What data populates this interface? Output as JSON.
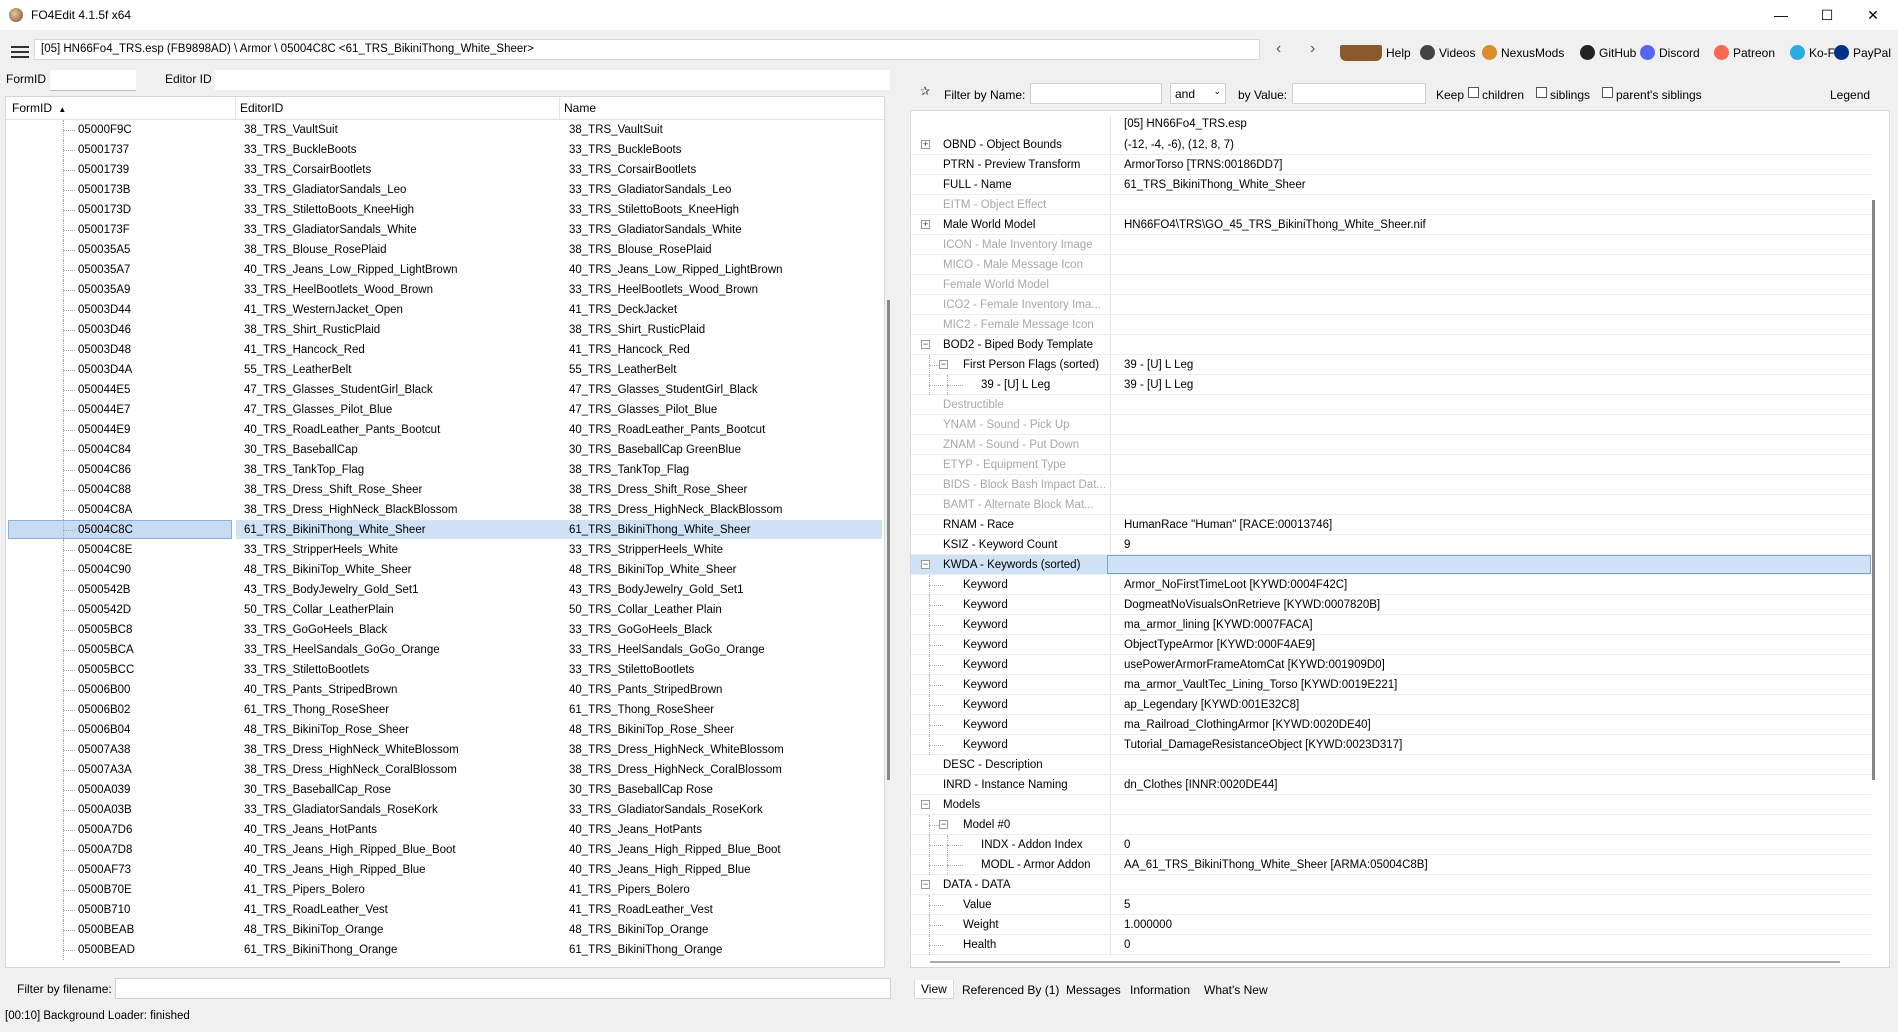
{
  "window": {
    "title": "FO4Edit 4.1.5f x64",
    "minimize": "—",
    "maximize": "☐",
    "close": "✕"
  },
  "toolbar": {
    "path": "[05] HN66Fo4_TRS.esp (FB9898AD) \\ Armor \\ 05004C8C <61_TRS_BikiniThong_White_Sheer>",
    "back": "‹",
    "forward": "›",
    "links": [
      {
        "label": "Help",
        "icon": "book-icon",
        "color": "#8b5a2b"
      },
      {
        "label": "Videos",
        "icon": "videos-icon",
        "color": "#444444"
      },
      {
        "label": "NexusMods",
        "icon": "nexusmods-icon",
        "color": "#d98e2b"
      },
      {
        "label": "GitHub",
        "icon": "github-icon",
        "color": "#222222"
      },
      {
        "label": "Discord",
        "icon": "discord-icon",
        "color": "#5865f2"
      },
      {
        "label": "Patreon",
        "icon": "patreon-icon",
        "color": "#f96854"
      },
      {
        "label": "Ko-Fi",
        "icon": "kofi-icon",
        "color": "#29abe0"
      },
      {
        "label": "PayPal",
        "icon": "paypal-icon",
        "color": "#003087"
      }
    ]
  },
  "search": {
    "formid_label": "FormID",
    "editorid_label": "Editor ID"
  },
  "left": {
    "columns": [
      "FormID",
      "EditorID",
      "Name"
    ],
    "sort_indicator": "▲",
    "rows": [
      {
        "formid": "05000F9C",
        "editorid": "38_TRS_VaultSuit",
        "name": "38_TRS_VaultSuit"
      },
      {
        "formid": "05001737",
        "editorid": "33_TRS_BuckleBoots",
        "name": "33_TRS_BuckleBoots"
      },
      {
        "formid": "05001739",
        "editorid": "33_TRS_CorsairBootlets",
        "name": "33_TRS_CorsairBootlets"
      },
      {
        "formid": "0500173B",
        "editorid": "33_TRS_GladiatorSandals_Leo",
        "name": "33_TRS_GladiatorSandals_Leo"
      },
      {
        "formid": "0500173D",
        "editorid": "33_TRS_StilettoBoots_KneeHigh",
        "name": "33_TRS_StilettoBoots_KneeHigh"
      },
      {
        "formid": "0500173F",
        "editorid": "33_TRS_GladiatorSandals_White",
        "name": "33_TRS_GladiatorSandals_White"
      },
      {
        "formid": "050035A5",
        "editorid": "38_TRS_Blouse_RosePlaid",
        "name": "38_TRS_Blouse_RosePlaid"
      },
      {
        "formid": "050035A7",
        "editorid": "40_TRS_Jeans_Low_Ripped_LightBrown",
        "name": "40_TRS_Jeans_Low_Ripped_LightBrown"
      },
      {
        "formid": "050035A9",
        "editorid": "33_TRS_HeelBootlets_Wood_Brown",
        "name": "33_TRS_HeelBootlets_Wood_Brown"
      },
      {
        "formid": "05003D44",
        "editorid": "41_TRS_WesternJacket_Open",
        "name": "41_TRS_DeckJacket"
      },
      {
        "formid": "05003D46",
        "editorid": "38_TRS_Shirt_RusticPlaid",
        "name": "38_TRS_Shirt_RusticPlaid"
      },
      {
        "formid": "05003D48",
        "editorid": "41_TRS_Hancock_Red",
        "name": "41_TRS_Hancock_Red"
      },
      {
        "formid": "05003D4A",
        "editorid": "55_TRS_LeatherBelt",
        "name": "55_TRS_LeatherBelt"
      },
      {
        "formid": "050044E5",
        "editorid": "47_TRS_Glasses_StudentGirl_Black",
        "name": "47_TRS_Glasses_StudentGirl_Black"
      },
      {
        "formid": "050044E7",
        "editorid": "47_TRS_Glasses_Pilot_Blue",
        "name": "47_TRS_Glasses_Pilot_Blue"
      },
      {
        "formid": "050044E9",
        "editorid": "40_TRS_RoadLeather_Pants_Bootcut",
        "name": "40_TRS_RoadLeather_Pants_Bootcut"
      },
      {
        "formid": "05004C84",
        "editorid": "30_TRS_BaseballCap",
        "name": "30_TRS_BaseballCap GreenBlue"
      },
      {
        "formid": "05004C86",
        "editorid": "38_TRS_TankTop_Flag",
        "name": "38_TRS_TankTop_Flag"
      },
      {
        "formid": "05004C88",
        "editorid": "38_TRS_Dress_Shift_Rose_Sheer",
        "name": "38_TRS_Dress_Shift_Rose_Sheer"
      },
      {
        "formid": "05004C8A",
        "editorid": "38_TRS_Dress_HighNeck_BlackBlossom",
        "name": "38_TRS_Dress_HighNeck_BlackBlossom"
      },
      {
        "formid": "05004C8C",
        "editorid": "61_TRS_BikiniThong_White_Sheer",
        "name": "61_TRS_BikiniThong_White_Sheer",
        "selected": true
      },
      {
        "formid": "05004C8E",
        "editorid": "33_TRS_StripperHeels_White",
        "name": "33_TRS_StripperHeels_White"
      },
      {
        "formid": "05004C90",
        "editorid": "48_TRS_BikiniTop_White_Sheer",
        "name": "48_TRS_BikiniTop_White_Sheer"
      },
      {
        "formid": "0500542B",
        "editorid": "43_TRS_BodyJewelry_Gold_Set1",
        "name": "43_TRS_BodyJewelry_Gold_Set1"
      },
      {
        "formid": "0500542D",
        "editorid": "50_TRS_Collar_LeatherPlain",
        "name": "50_TRS_Collar_Leather Plain"
      },
      {
        "formid": "05005BC8",
        "editorid": "33_TRS_GoGoHeels_Black",
        "name": "33_TRS_GoGoHeels_Black"
      },
      {
        "formid": "05005BCA",
        "editorid": "33_TRS_HeelSandals_GoGo_Orange",
        "name": "33_TRS_HeelSandals_GoGo_Orange"
      },
      {
        "formid": "05005BCC",
        "editorid": "33_TRS_StilettoBootlets",
        "name": "33_TRS_StilettoBootlets"
      },
      {
        "formid": "05006B00",
        "editorid": "40_TRS_Pants_StripedBrown",
        "name": "40_TRS_Pants_StripedBrown"
      },
      {
        "formid": "05006B02",
        "editorid": "61_TRS_Thong_RoseSheer",
        "name": "61_TRS_Thong_RoseSheer"
      },
      {
        "formid": "05006B04",
        "editorid": "48_TRS_BikiniTop_Rose_Sheer",
        "name": "48_TRS_BikiniTop_Rose_Sheer"
      },
      {
        "formid": "05007A38",
        "editorid": "38_TRS_Dress_HighNeck_WhiteBlossom",
        "name": "38_TRS_Dress_HighNeck_WhiteBlossom"
      },
      {
        "formid": "05007A3A",
        "editorid": "38_TRS_Dress_HighNeck_CoralBlossom",
        "name": "38_TRS_Dress_HighNeck_CoralBlossom"
      },
      {
        "formid": "0500A039",
        "editorid": "30_TRS_BaseballCap_Rose",
        "name": "30_TRS_BaseballCap Rose"
      },
      {
        "formid": "0500A03B",
        "editorid": "33_TRS_GladiatorSandals_RoseKork",
        "name": "33_TRS_GladiatorSandals_RoseKork"
      },
      {
        "formid": "0500A7D6",
        "editorid": "40_TRS_Jeans_HotPants",
        "name": "40_TRS_Jeans_HotPants"
      },
      {
        "formid": "0500A7D8",
        "editorid": "40_TRS_Jeans_High_Ripped_Blue_Boot",
        "name": "40_TRS_Jeans_High_Ripped_Blue_Boot"
      },
      {
        "formid": "0500AF73",
        "editorid": "40_TRS_Jeans_High_Ripped_Blue",
        "name": "40_TRS_Jeans_High_Ripped_Blue"
      },
      {
        "formid": "0500B70E",
        "editorid": "41_TRS_Pipers_Bolero",
        "name": "41_TRS_Pipers_Bolero"
      },
      {
        "formid": "0500B710",
        "editorid": "41_TRS_RoadLeather_Vest",
        "name": "41_TRS_RoadLeather_Vest"
      },
      {
        "formid": "0500BEAB",
        "editorid": "48_TRS_BikiniTop_Orange",
        "name": "48_TRS_BikiniTop_Orange"
      },
      {
        "formid": "0500BEAD",
        "editorid": "61_TRS_BikiniThong_Orange",
        "name": "61_TRS_BikiniThong_Orange"
      }
    ],
    "filter_label": "Filter by filename:"
  },
  "right": {
    "filter": {
      "name_label": "Filter by Name:",
      "op": "and",
      "value_label": "by Value:",
      "keep_label": "Keep",
      "children": "children",
      "siblings": "siblings",
      "parents_siblings": "parent's siblings",
      "legend": "Legend"
    },
    "file_header": "[05] HN66Fo4_TRS.esp",
    "rows": [
      {
        "label": "OBND - Object Bounds",
        "value": "(-12, -4, -6), (12, 8, 7)",
        "level": 0,
        "expander": "+"
      },
      {
        "label": "PTRN - Preview Transform",
        "value": "ArmorTorso [TRNS:00186DD7]",
        "level": 0
      },
      {
        "label": "FULL - Name",
        "value": "61_TRS_BikiniThong_White_Sheer",
        "level": 0
      },
      {
        "label": "EITM - Object Effect",
        "value": "",
        "level": 0,
        "dim": true
      },
      {
        "label": "Male World Model",
        "value": "HN66FO4\\TRS\\GO_45_TRS_BikiniThong_White_Sheer.nif",
        "level": 0,
        "expander": "+"
      },
      {
        "label": "ICON - Male Inventory Image",
        "value": "",
        "level": 0,
        "dim": true
      },
      {
        "label": "MICO - Male Message Icon",
        "value": "",
        "level": 0,
        "dim": true
      },
      {
        "label": "Female World Model",
        "value": "",
        "level": 0,
        "dim": true
      },
      {
        "label": "ICO2 - Female Inventory Ima...",
        "value": "",
        "level": 0,
        "dim": true
      },
      {
        "label": "MIC2 - Female Message Icon",
        "value": "",
        "level": 0,
        "dim": true
      },
      {
        "label": "BOD2 - Biped Body Template",
        "value": "",
        "level": 0,
        "expander": "−"
      },
      {
        "label": "First Person Flags (sorted)",
        "value": "39 - [U] L Leg",
        "level": 1,
        "expander": "−"
      },
      {
        "label": "39 - [U] L Leg",
        "value": "39 - [U] L Leg",
        "level": 2
      },
      {
        "label": "Destructible",
        "value": "",
        "level": 0,
        "dim": true
      },
      {
        "label": "YNAM - Sound - Pick Up",
        "value": "",
        "level": 0,
        "dim": true
      },
      {
        "label": "ZNAM - Sound - Put Down",
        "value": "",
        "level": 0,
        "dim": true
      },
      {
        "label": "ETYP - Equipment Type",
        "value": "",
        "level": 0,
        "dim": true
      },
      {
        "label": "BIDS - Block Bash Impact Dat...",
        "value": "",
        "level": 0,
        "dim": true
      },
      {
        "label": "BAMT - Alternate Block Mat...",
        "value": "",
        "level": 0,
        "dim": true
      },
      {
        "label": "RNAM - Race",
        "value": "HumanRace \"Human\" [RACE:00013746]",
        "level": 0
      },
      {
        "label": "KSIZ - Keyword Count",
        "value": "9",
        "level": 0
      },
      {
        "label": "KWDA - Keywords (sorted)",
        "value": "",
        "level": 0,
        "expander": "−",
        "highlight": true
      },
      {
        "label": "Keyword",
        "value": "Armor_NoFirstTimeLoot [KYWD:0004F42C]",
        "level": 1
      },
      {
        "label": "Keyword",
        "value": "DogmeatNoVisualsOnRetrieve [KYWD:0007820B]",
        "level": 1
      },
      {
        "label": "Keyword",
        "value": "ma_armor_lining [KYWD:0007FACA]",
        "level": 1
      },
      {
        "label": "Keyword",
        "value": "ObjectTypeArmor [KYWD:000F4AE9]",
        "level": 1
      },
      {
        "label": "Keyword",
        "value": "usePowerArmorFrameAtomCat [KYWD:001909D0]",
        "level": 1
      },
      {
        "label": "Keyword",
        "value": "ma_armor_VaultTec_Lining_Torso [KYWD:0019E221]",
        "level": 1
      },
      {
        "label": "Keyword",
        "value": "ap_Legendary [KYWD:001E32C8]",
        "level": 1
      },
      {
        "label": "Keyword",
        "value": "ma_Railroad_ClothingArmor [KYWD:0020DE40]",
        "level": 1
      },
      {
        "label": "Keyword",
        "value": "Tutorial_DamageResistanceObject [KYWD:0023D317]",
        "level": 1
      },
      {
        "label": "DESC - Description",
        "value": "",
        "level": 0
      },
      {
        "label": "INRD - Instance Naming",
        "value": "dn_Clothes [INNR:0020DE44]",
        "level": 0
      },
      {
        "label": "Models",
        "value": "",
        "level": 0,
        "expander": "−"
      },
      {
        "label": "Model #0",
        "value": "",
        "level": 1,
        "expander": "−"
      },
      {
        "label": "INDX - Addon Index",
        "value": "0",
        "level": 2
      },
      {
        "label": "MODL - Armor Addon",
        "value": "AA_61_TRS_BikiniThong_White_Sheer [ARMA:05004C8B]",
        "level": 2
      },
      {
        "label": "DATA - DATA",
        "value": "",
        "level": 0,
        "expander": "−"
      },
      {
        "label": "Value",
        "value": "5",
        "level": 1
      },
      {
        "label": "Weight",
        "value": "1.000000",
        "level": 1
      },
      {
        "label": "Health",
        "value": "0",
        "level": 1
      }
    ],
    "tabs": [
      "View",
      "Referenced By (1)",
      "Messages",
      "Information",
      "What's New"
    ]
  },
  "status": "[00:10] Background Loader: finished"
}
